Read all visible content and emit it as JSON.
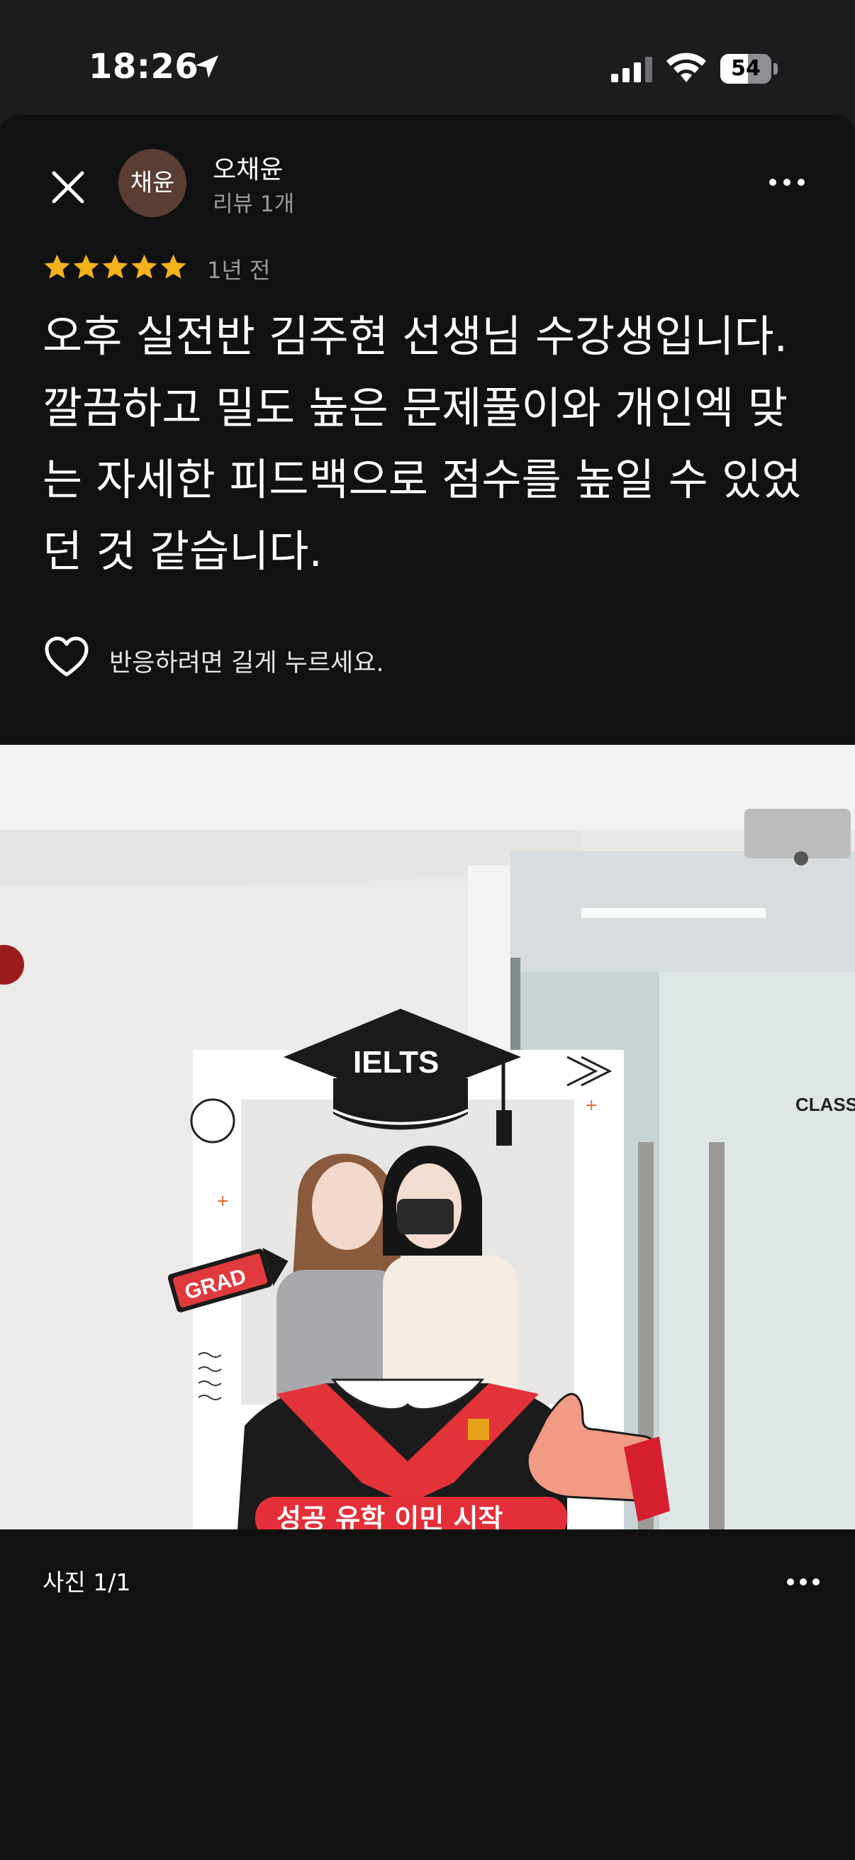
{
  "status_bar": {
    "time": "18:26",
    "battery_percent": 54,
    "battery_label": "54",
    "icons": [
      "location-arrow-icon",
      "cellular-signal-icon",
      "wifi-icon",
      "battery-icon"
    ]
  },
  "review": {
    "user": {
      "avatar_text": "채윤",
      "name": "오채윤",
      "review_count": "리뷰 1개"
    },
    "rating": 5,
    "rating_max": 5,
    "date": "1년 전",
    "body": "오후 실전반 김주현 선생님 수강생입니다. 깔끔하고 밀도 높은 문제풀이와 개인엑 맞는 자세한 피드백으로 점수를 높일 수 있었던 것 같습니다.",
    "react_hint": "반응하려면 길게 누르세요."
  },
  "photo": {
    "counter": "사진 1/1",
    "frame_texts": {
      "cap": "IELTS",
      "sign": "GRAD",
      "wall": "CLASS",
      "banner": "성공 유학 이민 시작"
    }
  },
  "colors": {
    "background": "#111111",
    "status_bar": "#1c1c1e",
    "star": "#f6b21a",
    "avatar": "#5a3d33",
    "secondary_text": "#9a9a9e"
  }
}
